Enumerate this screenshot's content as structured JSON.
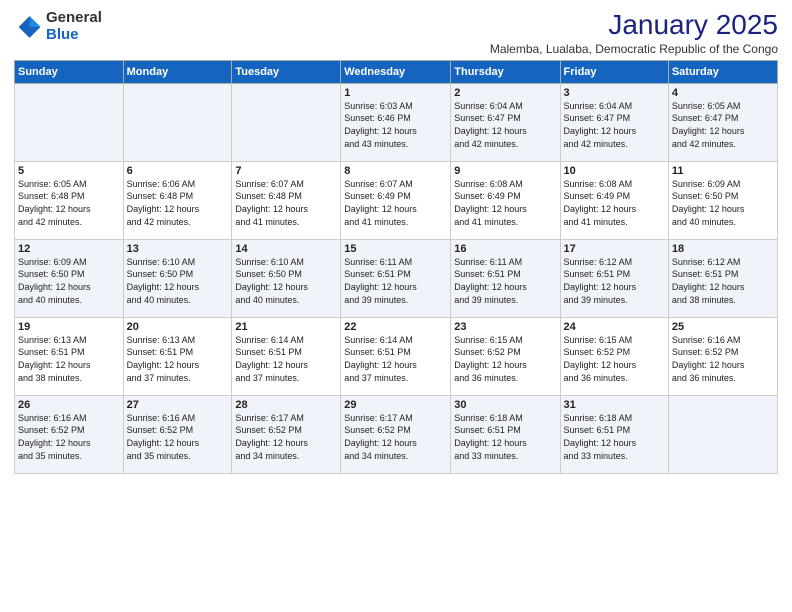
{
  "logo": {
    "general": "General",
    "blue": "Blue"
  },
  "header": {
    "month": "January 2025",
    "location": "Malemba, Lualaba, Democratic Republic of the Congo"
  },
  "weekdays": [
    "Sunday",
    "Monday",
    "Tuesday",
    "Wednesday",
    "Thursday",
    "Friday",
    "Saturday"
  ],
  "weeks": [
    [
      {
        "day": "",
        "info": ""
      },
      {
        "day": "",
        "info": ""
      },
      {
        "day": "",
        "info": ""
      },
      {
        "day": "1",
        "info": "Sunrise: 6:03 AM\nSunset: 6:46 PM\nDaylight: 12 hours\nand 43 minutes."
      },
      {
        "day": "2",
        "info": "Sunrise: 6:04 AM\nSunset: 6:47 PM\nDaylight: 12 hours\nand 42 minutes."
      },
      {
        "day": "3",
        "info": "Sunrise: 6:04 AM\nSunset: 6:47 PM\nDaylight: 12 hours\nand 42 minutes."
      },
      {
        "day": "4",
        "info": "Sunrise: 6:05 AM\nSunset: 6:47 PM\nDaylight: 12 hours\nand 42 minutes."
      }
    ],
    [
      {
        "day": "5",
        "info": "Sunrise: 6:05 AM\nSunset: 6:48 PM\nDaylight: 12 hours\nand 42 minutes."
      },
      {
        "day": "6",
        "info": "Sunrise: 6:06 AM\nSunset: 6:48 PM\nDaylight: 12 hours\nand 42 minutes."
      },
      {
        "day": "7",
        "info": "Sunrise: 6:07 AM\nSunset: 6:48 PM\nDaylight: 12 hours\nand 41 minutes."
      },
      {
        "day": "8",
        "info": "Sunrise: 6:07 AM\nSunset: 6:49 PM\nDaylight: 12 hours\nand 41 minutes."
      },
      {
        "day": "9",
        "info": "Sunrise: 6:08 AM\nSunset: 6:49 PM\nDaylight: 12 hours\nand 41 minutes."
      },
      {
        "day": "10",
        "info": "Sunrise: 6:08 AM\nSunset: 6:49 PM\nDaylight: 12 hours\nand 41 minutes."
      },
      {
        "day": "11",
        "info": "Sunrise: 6:09 AM\nSunset: 6:50 PM\nDaylight: 12 hours\nand 40 minutes."
      }
    ],
    [
      {
        "day": "12",
        "info": "Sunrise: 6:09 AM\nSunset: 6:50 PM\nDaylight: 12 hours\nand 40 minutes."
      },
      {
        "day": "13",
        "info": "Sunrise: 6:10 AM\nSunset: 6:50 PM\nDaylight: 12 hours\nand 40 minutes."
      },
      {
        "day": "14",
        "info": "Sunrise: 6:10 AM\nSunset: 6:50 PM\nDaylight: 12 hours\nand 40 minutes."
      },
      {
        "day": "15",
        "info": "Sunrise: 6:11 AM\nSunset: 6:51 PM\nDaylight: 12 hours\nand 39 minutes."
      },
      {
        "day": "16",
        "info": "Sunrise: 6:11 AM\nSunset: 6:51 PM\nDaylight: 12 hours\nand 39 minutes."
      },
      {
        "day": "17",
        "info": "Sunrise: 6:12 AM\nSunset: 6:51 PM\nDaylight: 12 hours\nand 39 minutes."
      },
      {
        "day": "18",
        "info": "Sunrise: 6:12 AM\nSunset: 6:51 PM\nDaylight: 12 hours\nand 38 minutes."
      }
    ],
    [
      {
        "day": "19",
        "info": "Sunrise: 6:13 AM\nSunset: 6:51 PM\nDaylight: 12 hours\nand 38 minutes."
      },
      {
        "day": "20",
        "info": "Sunrise: 6:13 AM\nSunset: 6:51 PM\nDaylight: 12 hours\nand 37 minutes."
      },
      {
        "day": "21",
        "info": "Sunrise: 6:14 AM\nSunset: 6:51 PM\nDaylight: 12 hours\nand 37 minutes."
      },
      {
        "day": "22",
        "info": "Sunrise: 6:14 AM\nSunset: 6:51 PM\nDaylight: 12 hours\nand 37 minutes."
      },
      {
        "day": "23",
        "info": "Sunrise: 6:15 AM\nSunset: 6:52 PM\nDaylight: 12 hours\nand 36 minutes."
      },
      {
        "day": "24",
        "info": "Sunrise: 6:15 AM\nSunset: 6:52 PM\nDaylight: 12 hours\nand 36 minutes."
      },
      {
        "day": "25",
        "info": "Sunrise: 6:16 AM\nSunset: 6:52 PM\nDaylight: 12 hours\nand 36 minutes."
      }
    ],
    [
      {
        "day": "26",
        "info": "Sunrise: 6:16 AM\nSunset: 6:52 PM\nDaylight: 12 hours\nand 35 minutes."
      },
      {
        "day": "27",
        "info": "Sunrise: 6:16 AM\nSunset: 6:52 PM\nDaylight: 12 hours\nand 35 minutes."
      },
      {
        "day": "28",
        "info": "Sunrise: 6:17 AM\nSunset: 6:52 PM\nDaylight: 12 hours\nand 34 minutes."
      },
      {
        "day": "29",
        "info": "Sunrise: 6:17 AM\nSunset: 6:52 PM\nDaylight: 12 hours\nand 34 minutes."
      },
      {
        "day": "30",
        "info": "Sunrise: 6:18 AM\nSunset: 6:51 PM\nDaylight: 12 hours\nand 33 minutes."
      },
      {
        "day": "31",
        "info": "Sunrise: 6:18 AM\nSunset: 6:51 PM\nDaylight: 12 hours\nand 33 minutes."
      },
      {
        "day": "",
        "info": ""
      }
    ]
  ]
}
